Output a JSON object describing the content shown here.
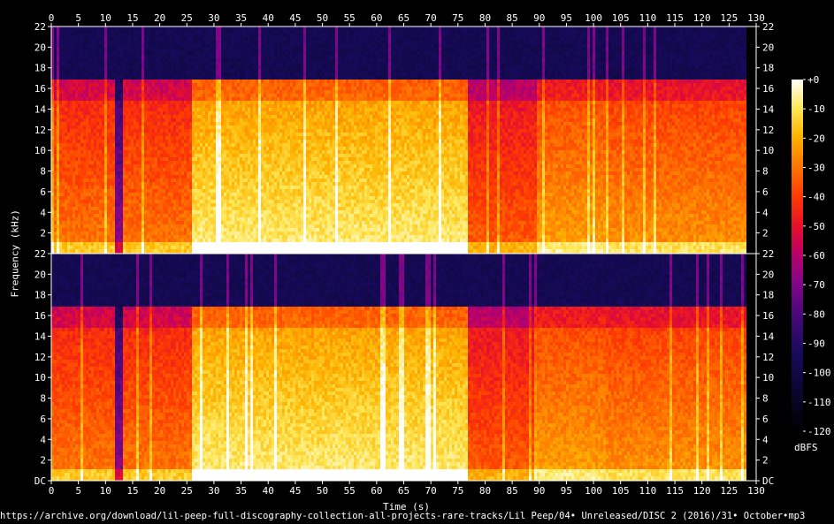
{
  "chart_data": {
    "type": "heatmap",
    "x": {
      "label": "Time (s)",
      "range": [
        0,
        128
      ],
      "ticks": [
        0,
        5,
        10,
        15,
        20,
        25,
        30,
        35,
        40,
        45,
        50,
        55,
        60,
        65,
        70,
        75,
        80,
        85,
        90,
        95,
        100,
        105,
        110,
        115,
        120,
        125,
        130
      ]
    },
    "y": {
      "label": "Frequency (kHz)",
      "range": [
        0,
        22
      ],
      "ticks": [
        0,
        2,
        4,
        6,
        8,
        10,
        12,
        14,
        16,
        18,
        20,
        22
      ],
      "zero_tick_label": "DC"
    },
    "channels": 2,
    "colorbar": {
      "label": "dBFS",
      "range": [
        -120,
        0
      ],
      "ticks": [
        0,
        -10,
        -20,
        -30,
        -40,
        -50,
        -60,
        -70,
        -80,
        -90,
        -100,
        -110,
        -120
      ],
      "top_tick_label": "+0"
    },
    "lowpass_cutoff_khz": 16.5,
    "audio_duration_s": 127.9,
    "sections": [
      {
        "start": 0.0,
        "end": 11.5,
        "level": 0.62
      },
      {
        "start": 11.5,
        "end": 13.0,
        "level": 0.3
      },
      {
        "start": 13.0,
        "end": 25.6,
        "level": 0.62
      },
      {
        "start": 25.6,
        "end": 76.8,
        "level": 0.8
      },
      {
        "start": 76.8,
        "end": 89.5,
        "level": 0.58
      },
      {
        "start": 89.5,
        "end": 101.8,
        "level": 0.68
      },
      {
        "start": 101.8,
        "end": 127.9,
        "level": 0.66
      }
    ]
  },
  "footer": {
    "source_path": "https://archive.org/download/lil-peep-full-discography-collection-all-projects-rare-tracks/Lil Peep/04• Unreleased/DISC 2 (2016)/31• October•mp3"
  }
}
